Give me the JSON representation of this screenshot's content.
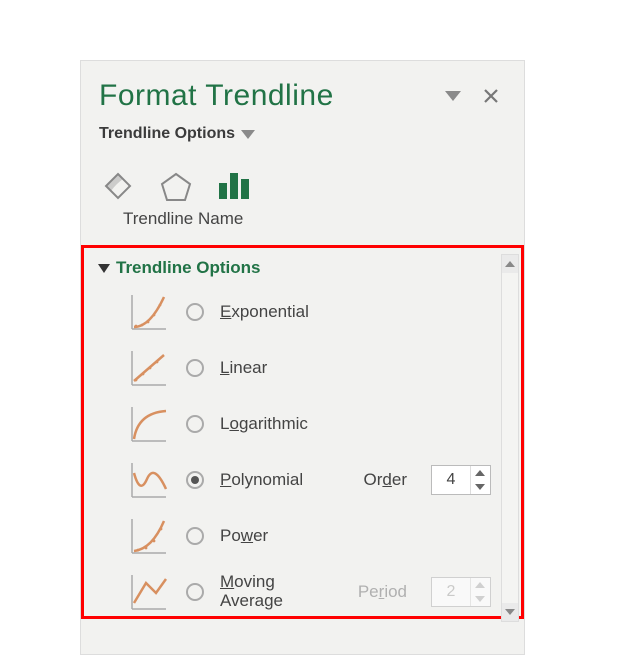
{
  "panel": {
    "title": "Format Trendline",
    "dropdown_label": "Trendline Options"
  },
  "section": {
    "title": "Trendline Options"
  },
  "options": {
    "exponential": {
      "label": "Exponential",
      "prefix": "E",
      "rest": "xponential"
    },
    "linear": {
      "label": "Linear",
      "prefix": "L",
      "rest": "inear"
    },
    "logarithmic": {
      "label": "Logarithmic",
      "prefix": "L",
      "rest1": "L",
      "rest": "ogarithmic"
    },
    "polynomial": {
      "label": "Polynomial",
      "prefix": "P",
      "rest": "olynomial"
    },
    "power": {
      "label": "Power",
      "pre": "Po",
      "under": "w",
      "post": "er"
    },
    "moving": {
      "line1_prefix": "M",
      "line1_rest": "oving",
      "line2": "Average"
    }
  },
  "params": {
    "order_label_pre": "Or",
    "order_label_u": "d",
    "order_label_post": "er",
    "order_value": "4",
    "period_label_pre": "Pe",
    "period_label_u": "r",
    "period_label_post": "iod",
    "period_value": "2"
  },
  "footer": {
    "trendline_name": "Trendline Name"
  }
}
